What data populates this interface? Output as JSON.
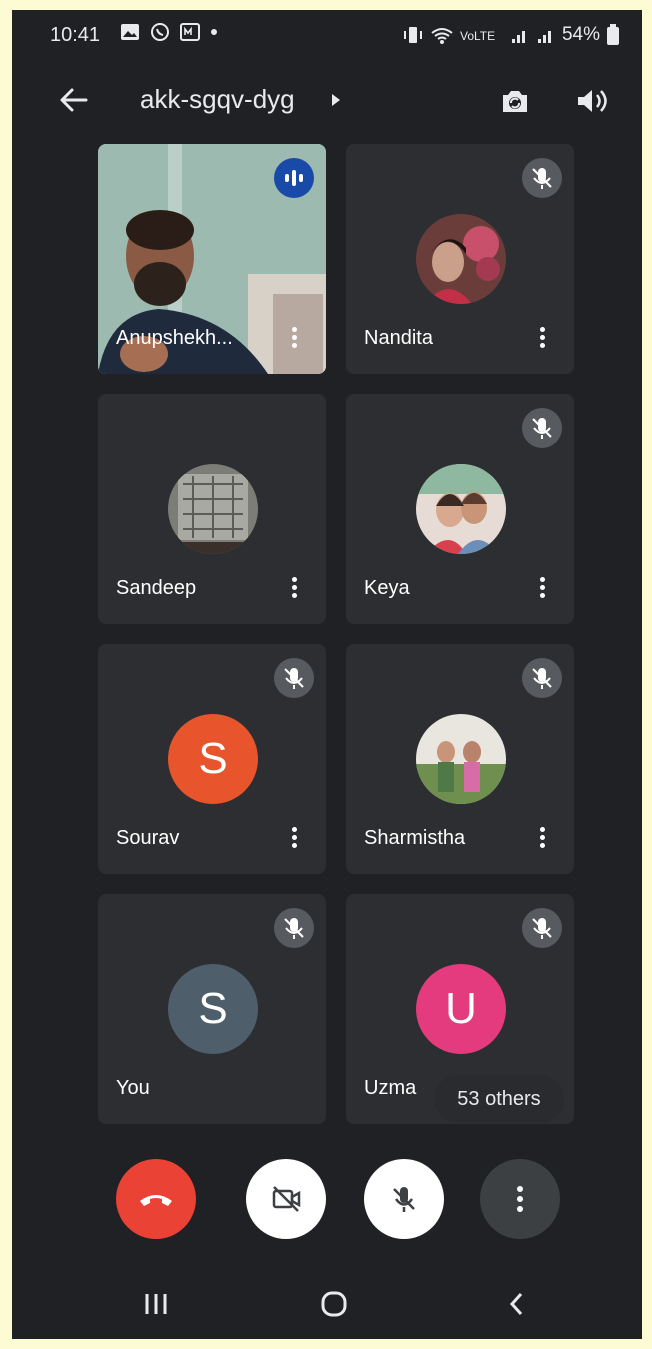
{
  "status_bar": {
    "time": "10:41",
    "battery": "54%",
    "notification_icons": [
      "gallery-icon",
      "whatsapp-icon",
      "media-icon",
      "dot-icon"
    ],
    "system_icons": [
      "vibrate-icon",
      "wifi-icon",
      "data-icon",
      "signal-icon",
      "signal-icon",
      "battery-icon"
    ]
  },
  "header": {
    "meeting_code": "akk-sgqv-dyg"
  },
  "participants": [
    {
      "name": "Anupshekh...",
      "type": "video",
      "muted": false,
      "speaking": true
    },
    {
      "name": "Nandita",
      "type": "photo",
      "muted": true
    },
    {
      "name": "Sandeep",
      "type": "photo",
      "muted": false
    },
    {
      "name": "Keya",
      "type": "photo",
      "muted": true
    },
    {
      "name": "Sourav",
      "type": "initial",
      "initial": "S",
      "color": "#e8542b",
      "muted": true
    },
    {
      "name": "Sharmistha",
      "type": "photo",
      "muted": true
    },
    {
      "name": "You",
      "type": "initial",
      "initial": "S",
      "color": "#4e5f6b",
      "muted": true
    },
    {
      "name": "Uzma",
      "type": "initial",
      "initial": "U",
      "color": "#e33b7d",
      "muted": true
    }
  ],
  "others_label": "53 others",
  "controls": {
    "end_call_color": "#ea4335",
    "camera_off": true,
    "mic_off": true
  },
  "colors": {
    "background": "#202124",
    "tile": "#2d2e31",
    "speaking": "#1a4aa8"
  }
}
